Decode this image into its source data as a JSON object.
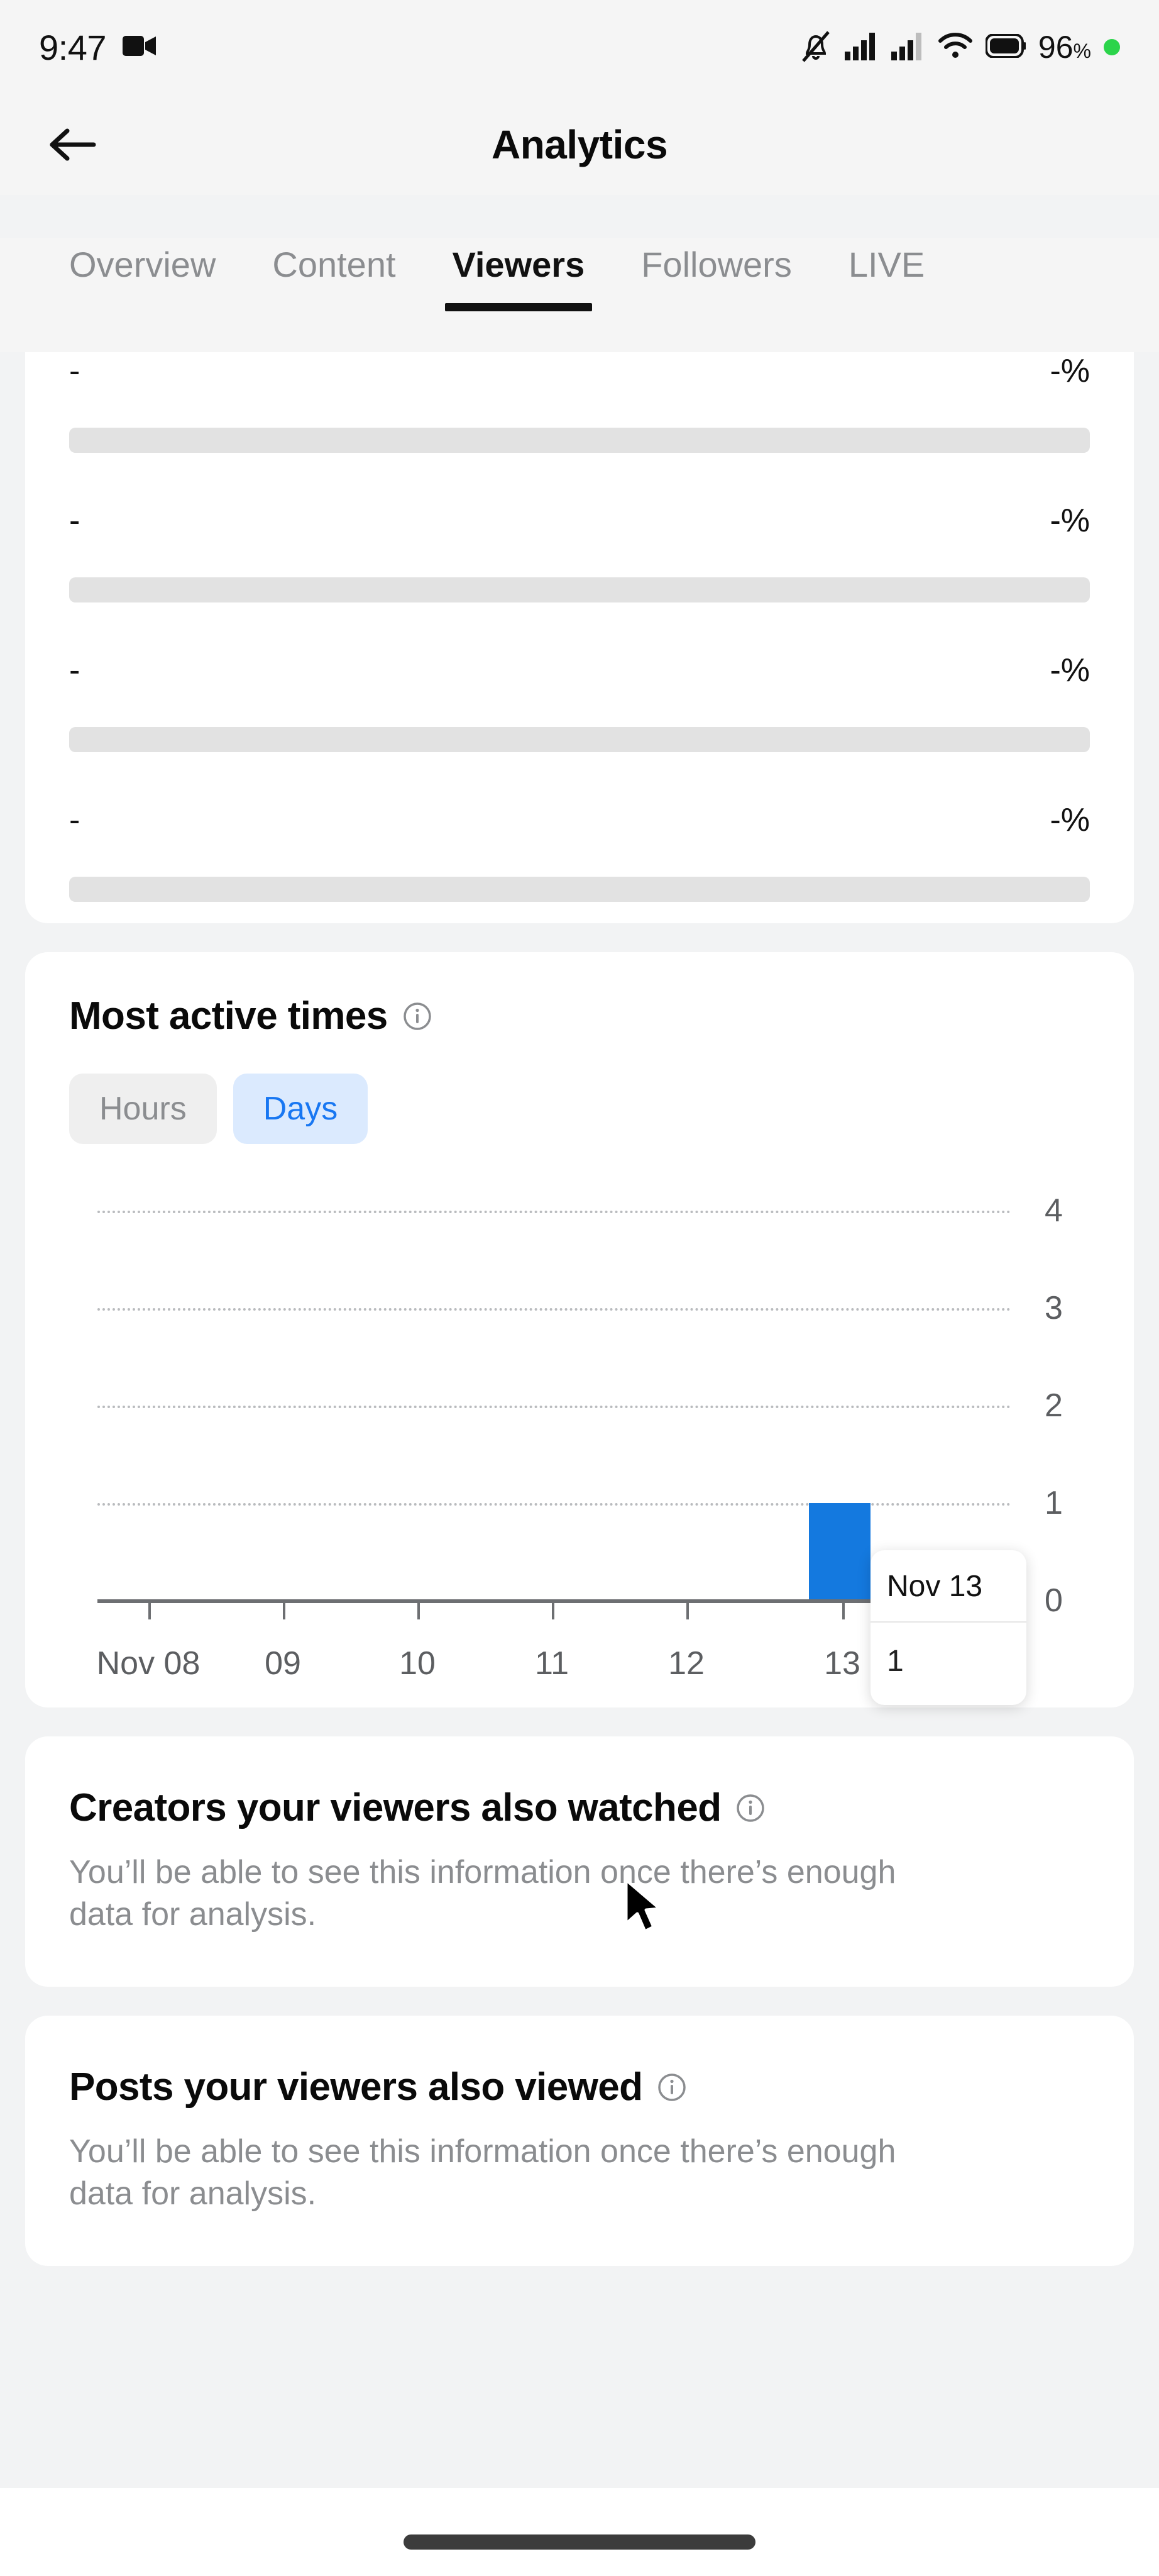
{
  "statusbar": {
    "time": "9:47",
    "battery_percent": "96",
    "percent_symbol": "%",
    "icons": [
      "video-camera-icon",
      "silent-mode-icon",
      "cellular-signal-1-icon",
      "cellular-signal-2-icon",
      "wifi-icon",
      "battery-icon",
      "recording-dot-icon"
    ]
  },
  "header": {
    "title": "Analytics",
    "back_label": "Back"
  },
  "tabs": [
    {
      "label": "Overview",
      "active": false
    },
    {
      "label": "Content",
      "active": false
    },
    {
      "label": "Viewers",
      "active": true
    },
    {
      "label": "Followers",
      "active": false
    },
    {
      "label": "LIVE",
      "active": false
    }
  ],
  "placeholder_card": {
    "rows": [
      {
        "key": "-",
        "value": "-%",
        "bar_percent": 100
      },
      {
        "key": "-",
        "value": "-%",
        "bar_percent": 100
      },
      {
        "key": "-",
        "value": "-%",
        "bar_percent": 100
      },
      {
        "key": "-",
        "value": "-%",
        "bar_percent": 100
      }
    ]
  },
  "most_active_times": {
    "title": "Most active times",
    "info_icon": "info-circle-icon",
    "segments": [
      {
        "label": "Hours",
        "active": false
      },
      {
        "label": "Days",
        "active": true
      }
    ],
    "tooltip": {
      "date": "Nov 13",
      "value": "1"
    }
  },
  "chart_data": {
    "type": "bar",
    "title": "Most active times",
    "categories": [
      "Nov 08",
      "09",
      "10",
      "11",
      "12",
      "13"
    ],
    "values": [
      0,
      0,
      0,
      0,
      0,
      1
    ],
    "xlabel": "",
    "ylabel": "",
    "ylim": [
      0,
      4
    ],
    "yticks": [
      0,
      1,
      2,
      3,
      4
    ],
    "grid": true,
    "gridlines_at": [
      1,
      2,
      3,
      4
    ],
    "legend": "none",
    "bar_color": "#1479df",
    "highlighted_category": "Nov 13",
    "highlighted_value": 1
  },
  "creators_card": {
    "title": "Creators your viewers also watched",
    "info_icon": "info-circle-icon",
    "description": "You’ll be able to see this information once there’s enough data for analysis."
  },
  "posts_card": {
    "title": "Posts your viewers also viewed",
    "info_icon": "info-circle-icon",
    "description": "You’ll be able to see this information once there’s enough data for analysis."
  },
  "colors": {
    "accent_blue": "#1877f2",
    "bar_blue": "#1479df",
    "seg_active_bg": "#dbeafe",
    "page_bg": "#f2f3f4",
    "card_bg": "#ffffff",
    "muted_text": "#8b8d90",
    "battery_dot_green": "#2bd44a"
  }
}
